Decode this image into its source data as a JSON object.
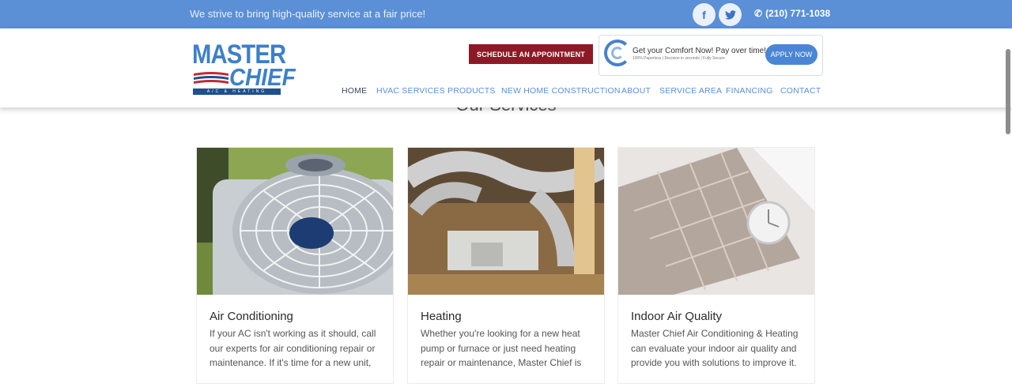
{
  "topbar": {
    "tagline": "We strive to bring high-quality service at a fair price!",
    "phone": "(210) 771-1038",
    "social": [
      {
        "icon": "facebook-icon",
        "glyph": "f"
      },
      {
        "icon": "twitter-icon",
        "glyph": "t"
      }
    ]
  },
  "logo": {
    "line1": "MASTER",
    "line2": "CHIEF",
    "sub": "A/C & HEATING"
  },
  "header": {
    "schedule_label": "SCHEDULE AN APPOINTMENT",
    "finance_title": "Get your Comfort Now! Pay over time!",
    "finance_sub": "100% Paperless | Decision in seconds | Fully Secure",
    "apply_label": "APPLY NOW"
  },
  "nav": {
    "items": [
      "HOME",
      "HVAC SERVICES",
      "PRODUCTS",
      "NEW HOME CONSTRUCTION",
      "ABOUT",
      "SERVICE AREA",
      "FINANCING",
      "CONTACT"
    ],
    "active": "HOME"
  },
  "main": {
    "section_title": "Our Services",
    "cards": [
      {
        "title": "Air Conditioning",
        "text": "If your AC isn't working as it should, call our experts for air conditioning repair or maintenance. If it's time for a new unit,"
      },
      {
        "title": "Heating",
        "text": "Whether you're looking for a new heat pump or furnace or just need heating repair or maintenance, Master Chief is"
      },
      {
        "title": "Indoor Air Quality",
        "text": "Master Chief Air Conditioning & Heating can evaluate your indoor air quality and provide you with solutions to improve it."
      }
    ]
  },
  "colors": {
    "topbar": "#5b8fd6",
    "schedule_button": "#8c1a26",
    "nav_link": "#5b8fd6",
    "nav_active": "#3d4a63"
  }
}
